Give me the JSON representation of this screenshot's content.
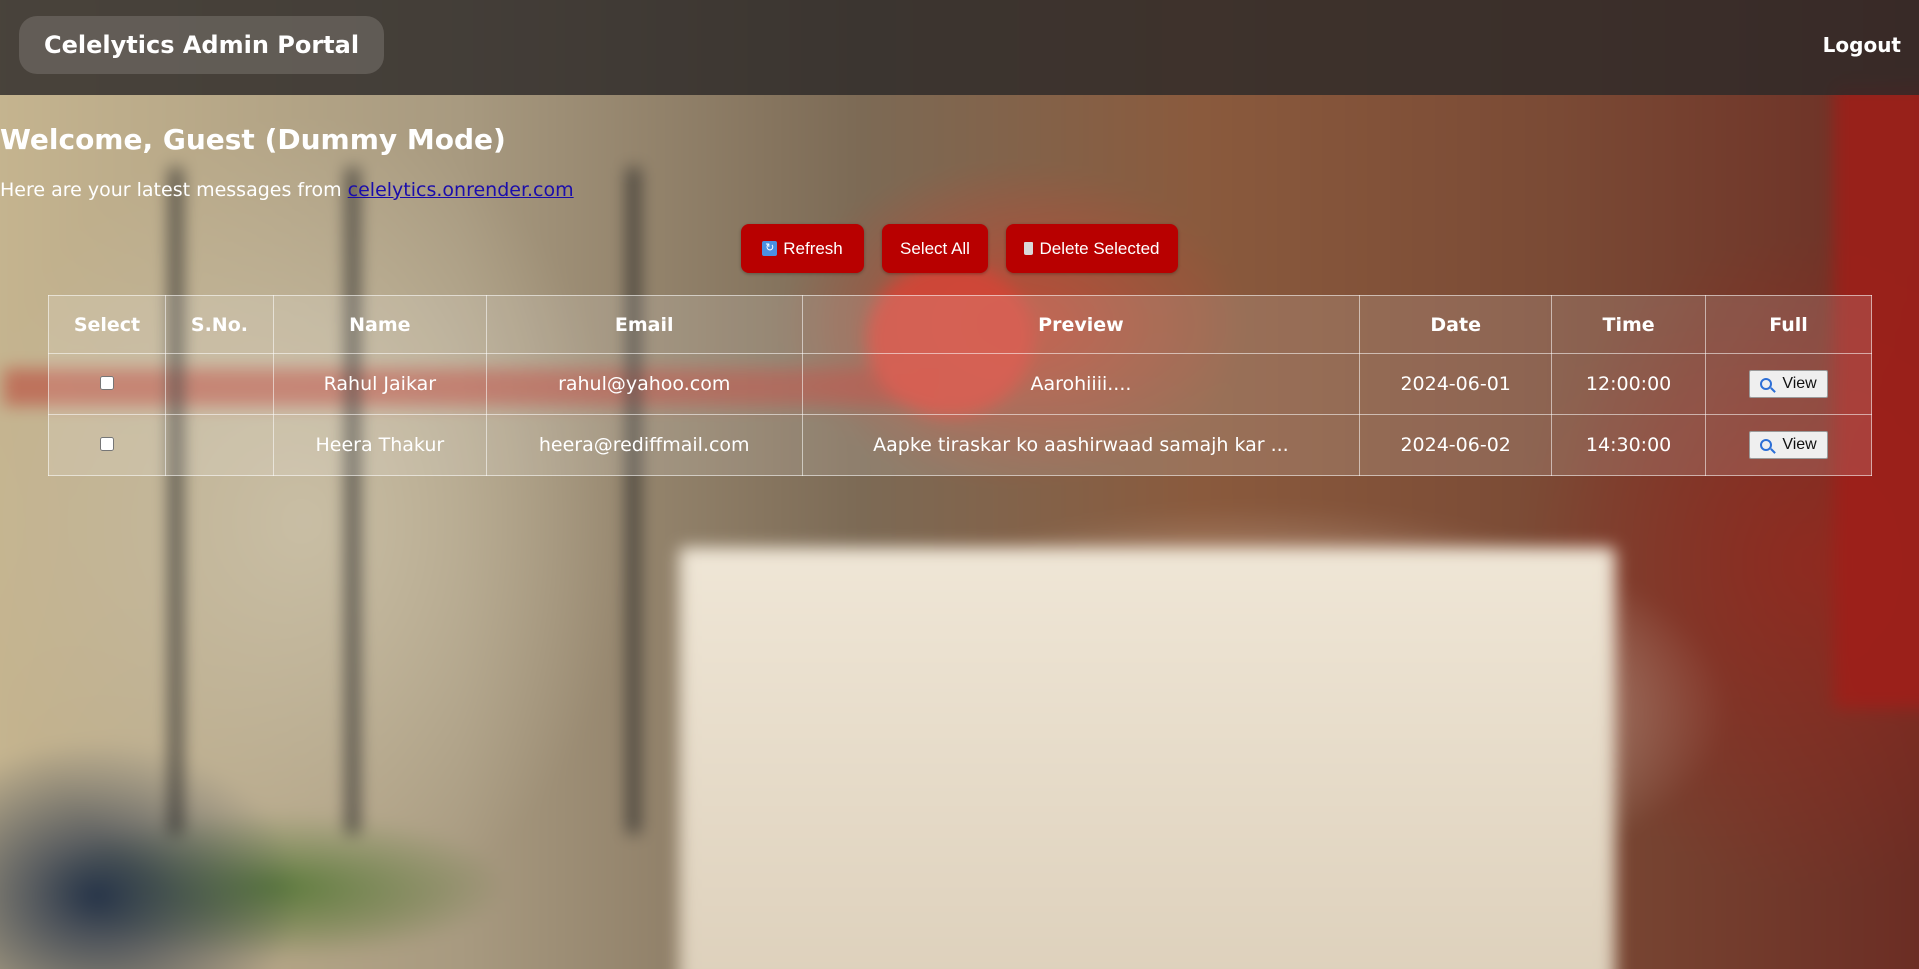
{
  "header": {
    "brand": "Celelytics Admin Portal",
    "logout": "Logout"
  },
  "welcome": {
    "title": "Welcome, Guest (Dummy Mode)",
    "sub_prefix": "Here are your latest messages from ",
    "link": "celelytics.onrender.com"
  },
  "actions": {
    "refresh": "Refresh",
    "select_all": "Select All",
    "delete_selected": "Delete Selected"
  },
  "table": {
    "headers": [
      "Select",
      "S.No.",
      "Name",
      "Email",
      "Preview",
      "Date",
      "Time",
      "Full"
    ],
    "rows": [
      {
        "sno": "",
        "name": "Rahul Jaikar",
        "email": "rahul@yahoo.com",
        "preview": "Aarohiiii....",
        "date": "2024-06-01",
        "time": "12:00:00",
        "view": "View"
      },
      {
        "sno": "",
        "name": "Heera Thakur",
        "email": "heera@rediffmail.com",
        "preview": "Aapke tiraskar ko aashirwaad samajh kar ...",
        "date": "2024-06-02",
        "time": "14:30:00",
        "view": "View"
      }
    ]
  },
  "colors": {
    "button_red": "#b80000",
    "link_blue": "#1a0dab"
  }
}
